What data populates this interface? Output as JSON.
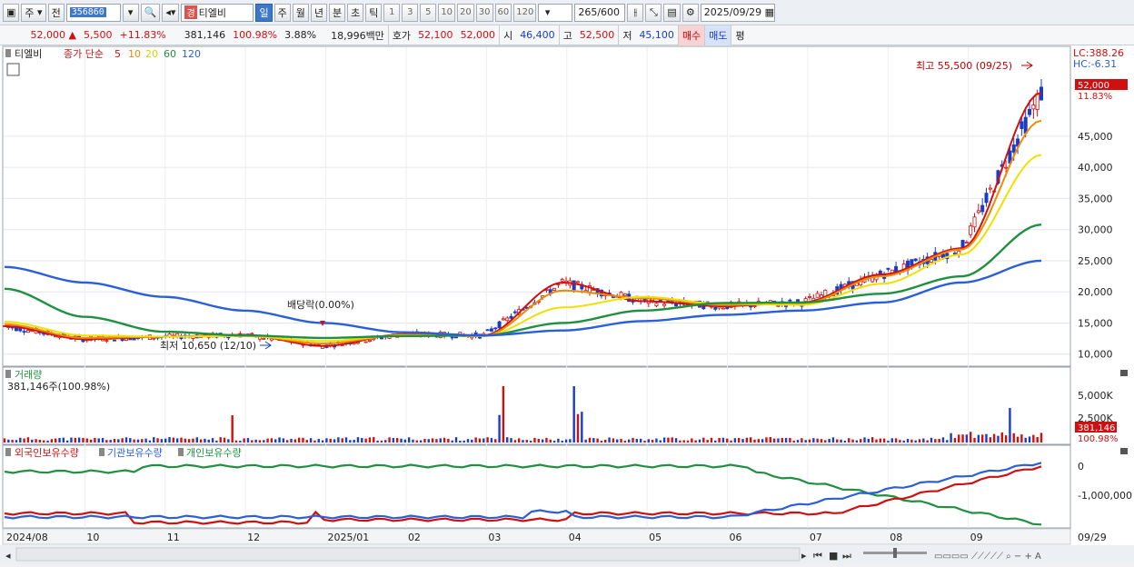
{
  "toolbar": {
    "type_sel": "주",
    "board_sel": "전",
    "stock_code": "356860",
    "stock_badge": "경",
    "stock_name": "티엘비",
    "periods": [
      "일",
      "주",
      "월",
      "년",
      "분",
      "초",
      "틱"
    ],
    "active_period": "일",
    "intervals": [
      "1",
      "3",
      "5",
      "10",
      "20",
      "30",
      "60",
      "120"
    ],
    "count_value": "265",
    "count_max": "/600",
    "date": "2025/09/29"
  },
  "quote": {
    "price": "52,000",
    "change": "5,500",
    "change_pct": "+11.83%",
    "volume": "381,146",
    "volume_ratio": "100.98%",
    "turnover": "3.88%",
    "amount": "18,996백만",
    "hoga_label": "호가",
    "ask": "52,100",
    "bid": "52,000",
    "open_label": "시",
    "open": "46,400",
    "high_label": "고",
    "high": "52,500",
    "low_label": "저",
    "low": "45,100",
    "buy_label": "매수",
    "sell_label": "매도",
    "eval_label": "평"
  },
  "price_pane": {
    "legend_name": "티엘비",
    "legend_ma": "종가 단순",
    "ma_periods": [
      "5",
      "10",
      "20",
      "60",
      "120"
    ],
    "ma_colors": [
      "#d01010",
      "#f08a00",
      "#f0e000",
      "#209040",
      "#2a5fd8"
    ],
    "lc": "LC:388.26",
    "hc": "HC:-6.31",
    "y_ticks": [
      "45,000",
      "40,000",
      "35,000",
      "30,000",
      "25,000",
      "20,000",
      "15,000",
      "10,000"
    ],
    "last_price_tag": "52,000",
    "last_pct_tag": "11.83%",
    "high_annotation": "최고 55,500 (09/25)",
    "low_annotation": "최저 10,650 (12/10)",
    "dividend_annotation": "배당락(0.00%)"
  },
  "volume_pane": {
    "title": "거래량",
    "value": "381,146주(100.98%)",
    "y_ticks": [
      "5,000K",
      "2,500K"
    ],
    "last_tag": "381,146",
    "last_pct_tag": "100.98%"
  },
  "holding_pane": {
    "series": [
      "외국인보유수량",
      "기관보유수량",
      "개인보유수량"
    ],
    "series_colors": [
      "#d01010",
      "#2a5fd8",
      "#209040"
    ],
    "y_ticks": [
      "0",
      "-1,000,000"
    ]
  },
  "x_axis": [
    "2024/08",
    "10",
    "11",
    "12",
    "2025/01",
    "02",
    "03",
    "04",
    "05",
    "06",
    "07",
    "08",
    "09",
    "09/29"
  ],
  "chart_data": {
    "type": "line",
    "title": "",
    "xlabel": "",
    "ylabel": "",
    "x": [
      "2024-08",
      "2024-09",
      "2024-10",
      "2024-11",
      "2024-12",
      "2025-01",
      "2025-02",
      "2025-03",
      "2025-04",
      "2025-05",
      "2025-06",
      "2025-07",
      "2025-08",
      "2025-09-29"
    ],
    "ylim": [
      8500,
      59000
    ],
    "series": [
      {
        "name": "5",
        "values": [
          14500,
          12400,
          12800,
          13100,
          11300,
          13200,
          13000,
          21500,
          18500,
          17700,
          18300,
          22800,
          27000,
          52000
        ]
      },
      {
        "name": "10",
        "values": [
          14800,
          12600,
          12800,
          13000,
          11700,
          13100,
          12900,
          20200,
          19000,
          17900,
          18100,
          22500,
          26800,
          47500
        ]
      },
      {
        "name": "20",
        "values": [
          15200,
          13000,
          12800,
          12900,
          12100,
          13000,
          12900,
          17500,
          19200,
          18100,
          17900,
          21300,
          26000,
          42000
        ]
      },
      {
        "name": "60",
        "values": [
          20500,
          16000,
          13600,
          13000,
          12600,
          12900,
          13000,
          15000,
          17000,
          18200,
          18300,
          19700,
          22500,
          30800
        ]
      },
      {
        "name": "120",
        "values": [
          24000,
          21500,
          19200,
          17000,
          15000,
          13500,
          13000,
          13800,
          15300,
          16300,
          17000,
          18300,
          21500,
          25000
        ]
      }
    ]
  }
}
